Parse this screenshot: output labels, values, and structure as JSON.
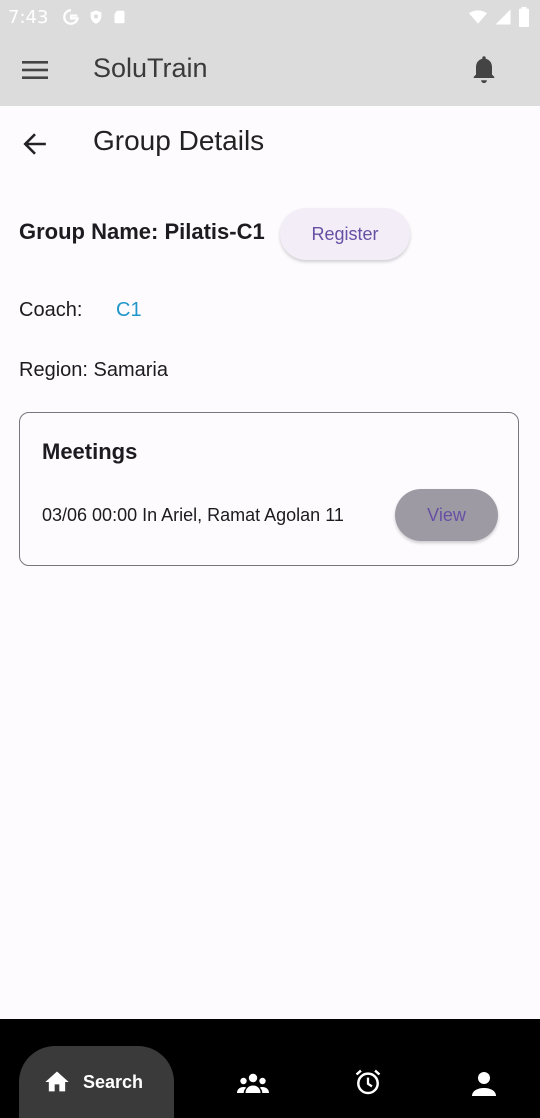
{
  "status_bar": {
    "time": "7:43"
  },
  "app_bar": {
    "title": "SoluTrain"
  },
  "page": {
    "title": "Group Details"
  },
  "group": {
    "name_label": "Group Name: Pilatis-C1",
    "register_label": "Register",
    "coach_label": "Coach:",
    "coach_value": "C1",
    "region_label": "Region: Samaria"
  },
  "meetings": {
    "title": "Meetings",
    "items": [
      {
        "text": "03/06 00:00 In Ariel, Ramat Agolan 11",
        "button_label": "View"
      }
    ]
  },
  "bottom_nav": {
    "items": [
      {
        "label": "Search",
        "icon": "home-icon",
        "active": true
      },
      {
        "label": "",
        "icon": "groups-icon",
        "active": false
      },
      {
        "label": "",
        "icon": "alarm-icon",
        "active": false
      },
      {
        "label": "",
        "icon": "person-icon",
        "active": false
      }
    ]
  },
  "colors": {
    "accent": "#6750a4",
    "link": "#2196c8",
    "app_bar": "#dcdcdc",
    "background": "#fefbff",
    "nav_background": "#000000"
  }
}
